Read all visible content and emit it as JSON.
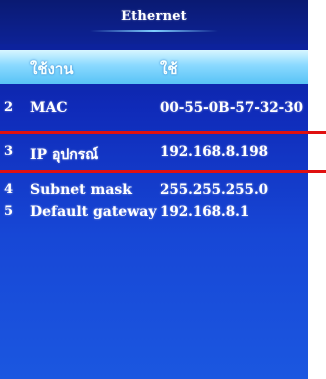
{
  "window": {
    "title": "Ethernet"
  },
  "header": {
    "col1": "ใช้งาน",
    "col2": "ใช้"
  },
  "rows": [
    {
      "index": "2",
      "label": "MAC",
      "value": "00-55-0B-57-32-30"
    },
    {
      "index": "3",
      "label": "IP อุปกรณ์",
      "value": "192.168.8.198"
    },
    {
      "index": "4",
      "label": "Subnet mask",
      "value": "255.255.255.0"
    },
    {
      "index": "5",
      "label": "Default gateway",
      "value": "192.168.8.1"
    }
  ],
  "colors": {
    "highlight_line": "#e01010",
    "selected_row": "#8ad9ff",
    "background": "#1747d6"
  }
}
